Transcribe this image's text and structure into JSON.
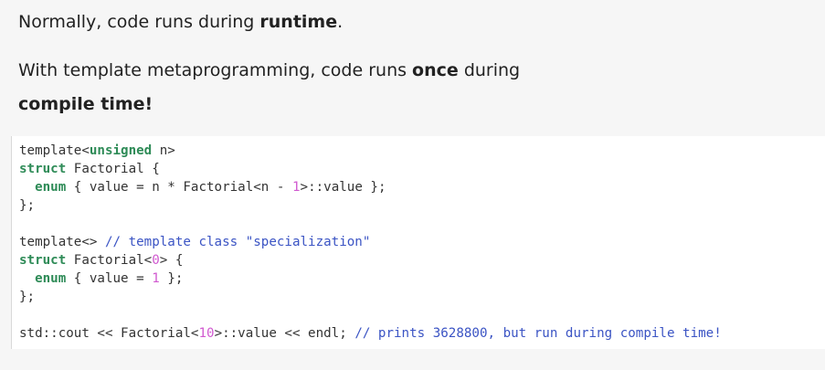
{
  "paragraphs": {
    "p1_prefix": "Normally, code runs during ",
    "p1_bold": "runtime",
    "p1_suffix": ".",
    "p2_prefix": "With template metaprogramming, code runs ",
    "p2_bold": "once",
    "p2_suffix": " during",
    "p3_bold": "compile time!"
  },
  "code": {
    "l1_a": "template<",
    "l1_kw": "unsigned",
    "l1_b": " n>",
    "l2_kw": "struct",
    "l2_b": " Factorial {",
    "l3_indent": "  ",
    "l3_kw": "enum",
    "l3_b": " { value = n * Factorial<n - ",
    "l3_num": "1",
    "l3_c": ">::value };",
    "l4": "};",
    "l6_a": "template<> ",
    "l6_cm": "// template class ",
    "l6_st": "\"specialization\"",
    "l7_kw": "struct",
    "l7_b": " Factorial<",
    "l7_num": "0",
    "l7_c": "> {",
    "l8_indent": "  ",
    "l8_kw": "enum",
    "l8_b": " { value = ",
    "l8_num": "1",
    "l8_c": " };",
    "l9": "};",
    "l11_a": "std::cout << Factorial<",
    "l11_num": "10",
    "l11_b": ">::value << endl; ",
    "l11_cm": "// prints 3628800, but run during compile time!"
  },
  "colors": {
    "keyword": "#2e8b57",
    "comment": "#3b54c4",
    "number": "#d15ad0",
    "background": "#f6f6f6"
  }
}
